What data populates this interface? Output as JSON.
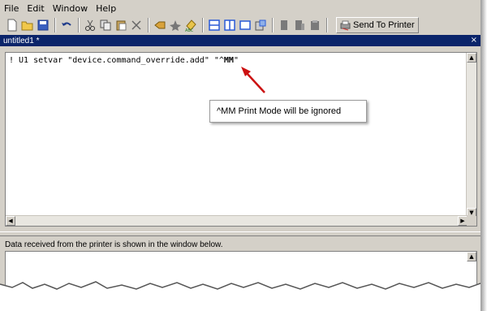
{
  "menu": {
    "file": "File",
    "edit": "Edit",
    "window": "Window",
    "help": "Help"
  },
  "toolbar": {
    "send_label": "Send To Printer",
    "icons": [
      "new-document-icon",
      "open-folder-icon",
      "save-icon",
      "undo-icon",
      "cut-icon",
      "copy-icon",
      "paste-icon",
      "delete-icon",
      "tool-a-icon",
      "tool-b-icon",
      "tool-c-icon",
      "layout-horizontal-icon",
      "layout-vertical-icon",
      "layout-single-icon",
      "layout-other-icon",
      "printer-a-icon",
      "printer-b-icon",
      "printer-c-icon",
      "send-to-printer-icon"
    ]
  },
  "tab": {
    "title": "untitled1 *",
    "close": "×"
  },
  "editor": {
    "line_prefix": "! U1 setvar \"device.command_override.add\" \"^",
    "line_highlight": "MM",
    "line_suffix": "\""
  },
  "tooltip": {
    "text": "^MM Print Mode will be ignored"
  },
  "output": {
    "label": "Data received from the printer is shown in the window below."
  },
  "colors": {
    "tab_bg": "#0a246a",
    "window_bg": "#d4d0c8",
    "arrow": "#cc1111"
  }
}
